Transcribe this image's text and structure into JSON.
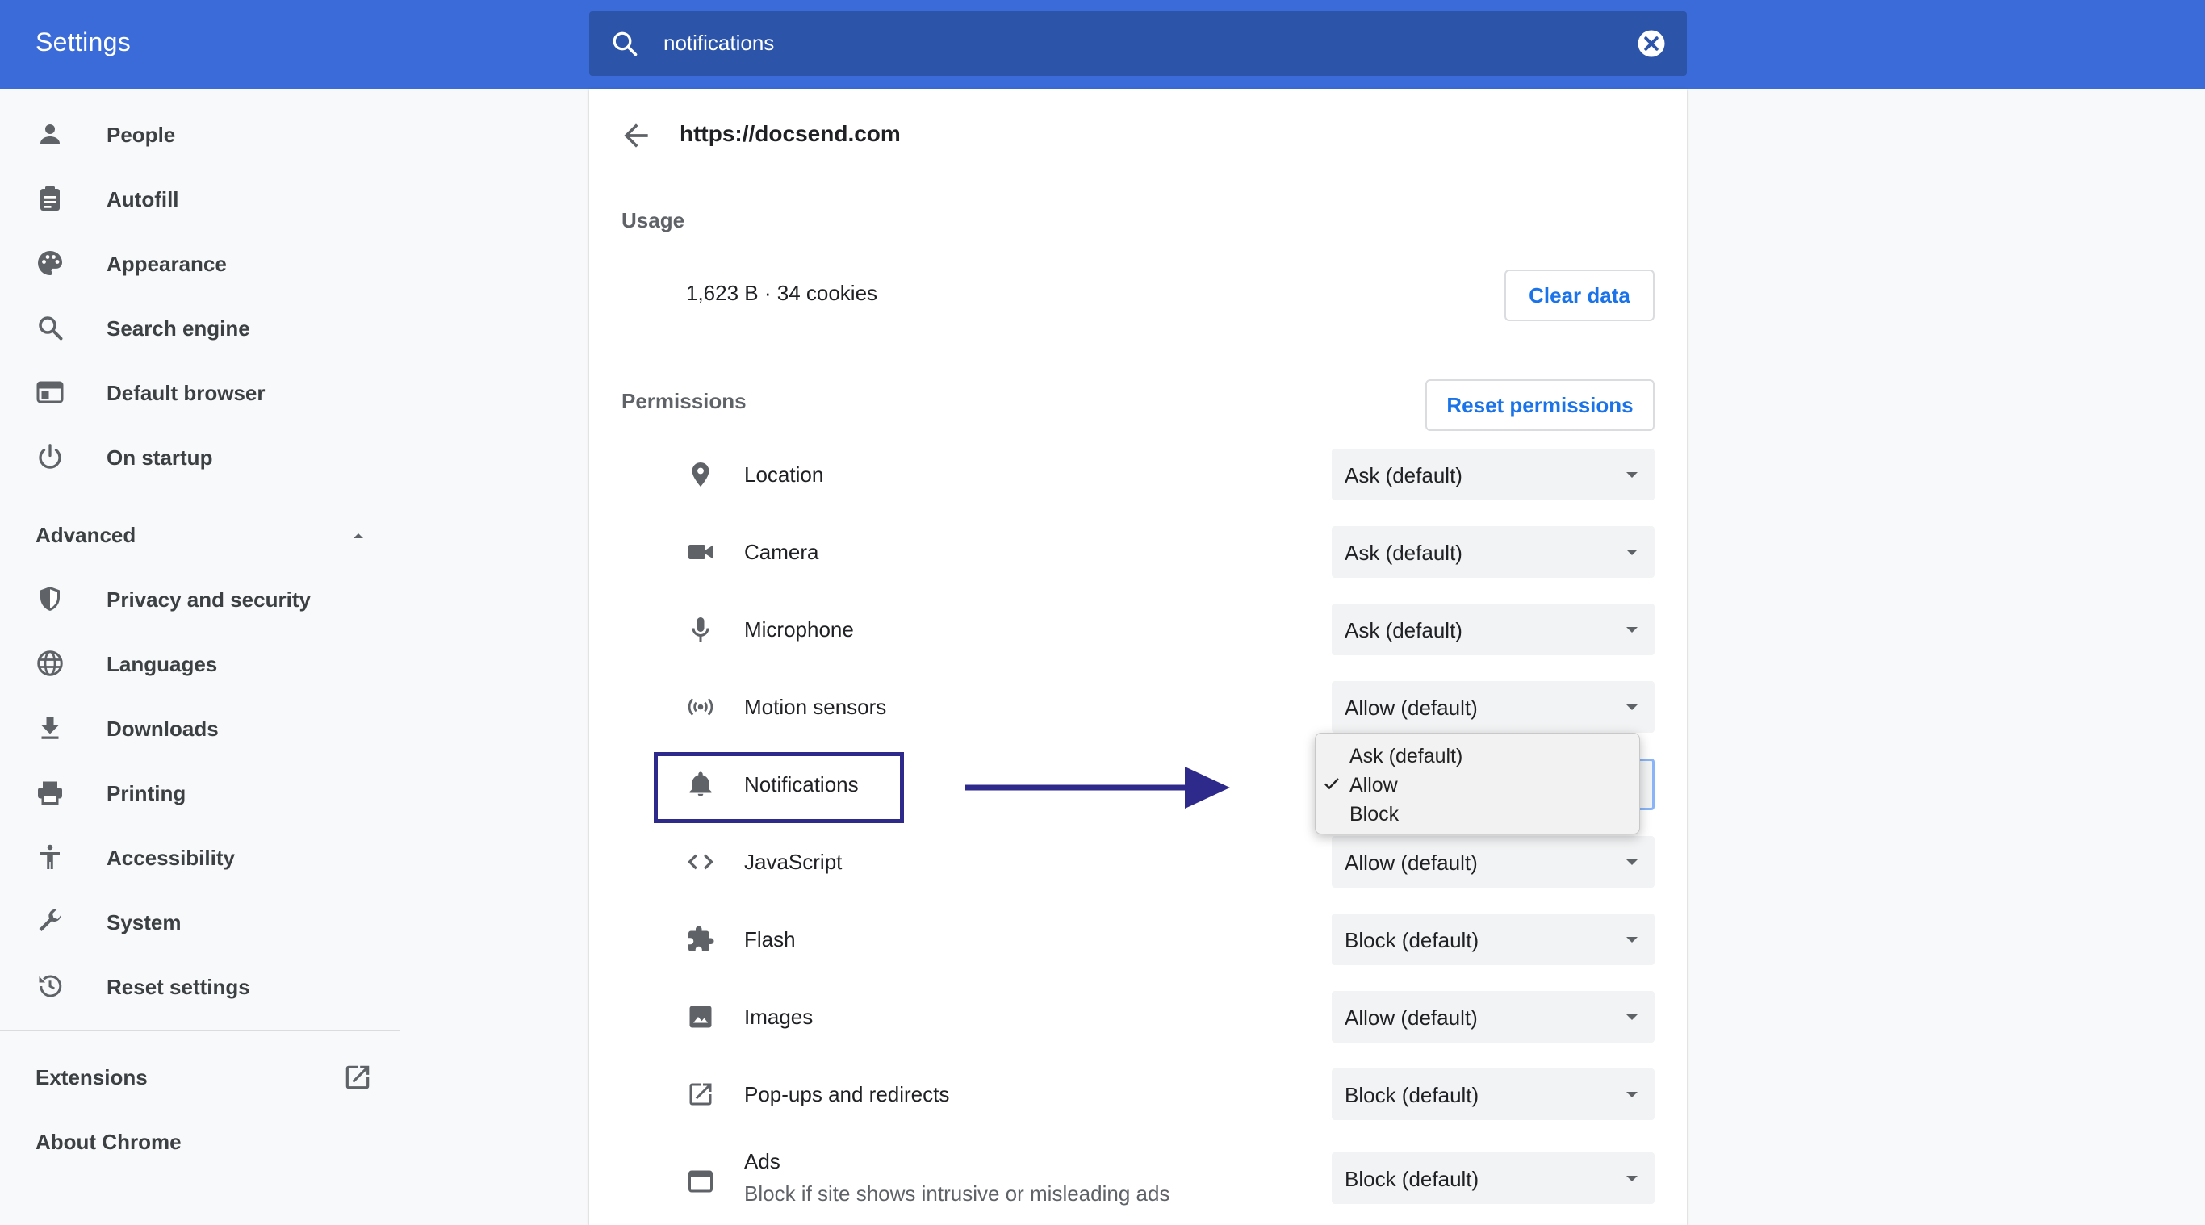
{
  "colors": {
    "header": "#3b6bd8",
    "search_bg": "#2c55a9",
    "accent": "#1a73e8",
    "highlight": "#2e2a8c"
  },
  "header": {
    "title": "Settings"
  },
  "search": {
    "query": "notifications",
    "icon": "search-icon",
    "clear_icon": "clear-icon"
  },
  "sidebar": {
    "items": [
      {
        "label": "People",
        "icon": "person-icon"
      },
      {
        "label": "Autofill",
        "icon": "clipboard-icon"
      },
      {
        "label": "Appearance",
        "icon": "palette-icon"
      },
      {
        "label": "Search engine",
        "icon": "search-icon"
      },
      {
        "label": "Default browser",
        "icon": "browser-icon"
      },
      {
        "label": "On startup",
        "icon": "power-icon"
      }
    ],
    "advanced": {
      "label": "Advanced",
      "expanded": true
    },
    "advanced_items": [
      {
        "label": "Privacy and security",
        "icon": "shield-icon"
      },
      {
        "label": "Languages",
        "icon": "globe-icon"
      },
      {
        "label": "Downloads",
        "icon": "download-icon"
      },
      {
        "label": "Printing",
        "icon": "printer-icon"
      },
      {
        "label": "Accessibility",
        "icon": "accessibility-icon"
      },
      {
        "label": "System",
        "icon": "wrench-icon"
      },
      {
        "label": "Reset settings",
        "icon": "history-icon"
      }
    ],
    "extensions": {
      "label": "Extensions",
      "icon": "open-external-icon"
    },
    "about": {
      "label": "About Chrome"
    }
  },
  "site": {
    "url": "https://docsend.com",
    "usage_title": "Usage",
    "usage_value": "1,623 B · 34 cookies",
    "clear_data_label": "Clear data",
    "permissions_title": "Permissions",
    "reset_permissions_label": "Reset permissions"
  },
  "permissions": [
    {
      "label": "Location",
      "value": "Ask (default)",
      "icon": "location-pin-icon"
    },
    {
      "label": "Camera",
      "value": "Ask (default)",
      "icon": "camera-icon"
    },
    {
      "label": "Microphone",
      "value": "Ask (default)",
      "icon": "microphone-icon"
    },
    {
      "label": "Motion sensors",
      "value": "Allow (default)",
      "icon": "sensors-icon"
    },
    {
      "label": "Notifications",
      "value": "Allow",
      "icon": "bell-icon"
    },
    {
      "label": "JavaScript",
      "value": "Allow (default)",
      "icon": "code-icon"
    },
    {
      "label": "Flash",
      "value": "Block (default)",
      "icon": "puzzle-icon"
    },
    {
      "label": "Images",
      "value": "Allow (default)",
      "icon": "image-icon"
    },
    {
      "label": "Pop-ups and redirects",
      "value": "Block (default)",
      "icon": "open-external-icon"
    },
    {
      "label": "Ads",
      "sublabel": "Block if site shows intrusive or misleading ads",
      "value": "Block (default)",
      "icon": "window-icon"
    }
  ],
  "notifications_dropdown": {
    "options": [
      "Ask (default)",
      "Allow",
      "Block"
    ],
    "selected": "Allow"
  }
}
